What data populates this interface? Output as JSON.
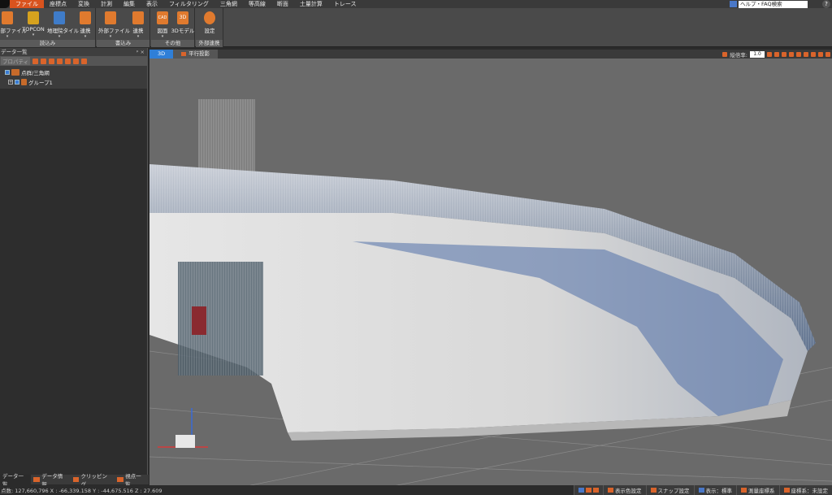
{
  "menu": {
    "items": [
      "ファイル",
      "座標点",
      "変換",
      "計測",
      "編集",
      "表示",
      "フィルタリング",
      "三角網",
      "等高線",
      "断面",
      "土量計算",
      "トレース"
    ],
    "active_index": 0,
    "help_label": "ヘルプ・FAQ検索",
    "help_icon": "?"
  },
  "ribbon": {
    "groups": [
      {
        "label": "読込み",
        "buttons": [
          "外部ファイル",
          "TOPCON",
          "地理院タイル",
          "連携"
        ]
      },
      {
        "label": "書込み",
        "buttons": [
          "外部ファイル",
          "連携"
        ]
      },
      {
        "label": "その他",
        "buttons": [
          "図面",
          "3Dモデル"
        ]
      },
      {
        "label": "外部連携",
        "buttons": [
          "設定"
        ]
      }
    ],
    "icon_text": {
      "cad": "CAD",
      "3d": "3D"
    }
  },
  "left_panel": {
    "title": "データ一覧",
    "pin": "ᵖ ×",
    "property_label": "プロパティ",
    "tree": [
      {
        "label": "点群/三角網"
      },
      {
        "label": "グループ1"
      }
    ],
    "tabs": [
      {
        "label": "データ一覧",
        "active": true
      },
      {
        "label": "データ情報",
        "active": false
      },
      {
        "label": "クリッピング",
        "active": false
      },
      {
        "label": "視点一覧",
        "active": false
      }
    ]
  },
  "view": {
    "tabs": [
      {
        "label": "3D",
        "active": true
      },
      {
        "label": "平行投影",
        "active": false
      }
    ],
    "scale_label": "縦倍率:",
    "scale_value": "1.0"
  },
  "status": {
    "coords": "点数: 127,660,796   X : -66,339.158  Y : -44,675.516  Z : 27.609",
    "buttons": [
      {
        "label": "表示色設定",
        "icon": "palette-icon"
      },
      {
        "label": "スナップ設定",
        "icon": "snap-icon"
      },
      {
        "label": "表示：標準",
        "icon": "display-icon"
      },
      {
        "label": "測量座標系",
        "icon": "survey-coord-icon"
      },
      {
        "label": "座標系：未設定",
        "icon": "coord-system-icon"
      }
    ]
  }
}
